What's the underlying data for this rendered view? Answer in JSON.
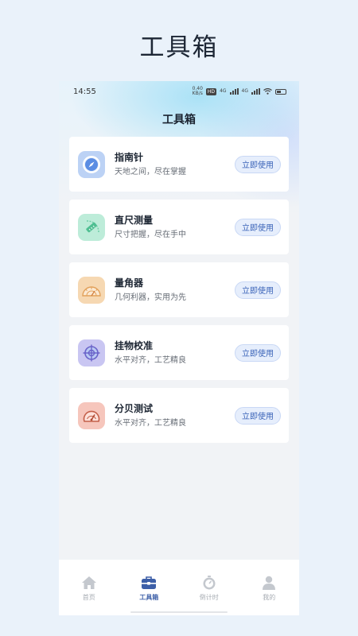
{
  "page": {
    "heading": "工具箱"
  },
  "status_bar": {
    "time": "14:55",
    "net_speed": "0.40",
    "net_unit": "KB/s",
    "hd": "HD",
    "net_a": "4G",
    "net_b": "4G"
  },
  "nav": {
    "title": "工具箱"
  },
  "tools": [
    {
      "name": "指南针",
      "desc": "天地之间，尽在掌握",
      "button": "立即使用",
      "icon": "compass-icon",
      "bg": "#bcd2f5"
    },
    {
      "name": "直尺测量",
      "desc": "尺寸把握，尽在手中",
      "button": "立即使用",
      "icon": "ruler-icon",
      "bg": "#bdecd9"
    },
    {
      "name": "量角器",
      "desc": "几何利器，实用为先",
      "button": "立即使用",
      "icon": "protractor-icon",
      "bg": "#f6d8b2"
    },
    {
      "name": "挂物校准",
      "desc": "水平对齐，工艺精良",
      "button": "立即使用",
      "icon": "crosshair-icon",
      "bg": "#c9c6f2"
    },
    {
      "name": "分贝测试",
      "desc": "水平对齐，工艺精良",
      "button": "立即使用",
      "icon": "decibel-meter-icon",
      "bg": "#f6c6bc"
    }
  ],
  "tabbar": {
    "items": [
      {
        "label": "首页",
        "icon": "home-icon",
        "active": false
      },
      {
        "label": "工具箱",
        "icon": "toolbox-icon",
        "active": true
      },
      {
        "label": "倒计时",
        "icon": "stopwatch-icon",
        "active": false
      },
      {
        "label": "我的",
        "icon": "user-icon",
        "active": false
      }
    ]
  },
  "colors": {
    "accent": "#3d5fa8",
    "button_text": "#3a63b8",
    "page_bg": "#eaf2fa"
  }
}
